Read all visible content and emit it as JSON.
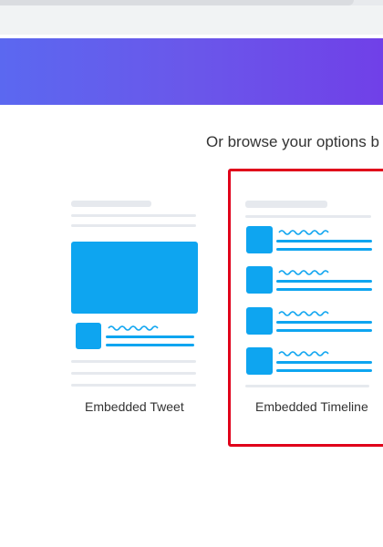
{
  "browse_heading": "Or browse your options b",
  "options": [
    {
      "label": "Embedded Tweet",
      "icon": "embedded-tweet-illustration"
    },
    {
      "label": "Embedded Timeline",
      "icon": "embedded-timeline-illustration",
      "selected": true
    }
  ],
  "colors": {
    "hero_gradient_start": "#5b68f0",
    "hero_gradient_end": "#7040e8",
    "accent_blue": "#0ea5f0",
    "placeholder_grey": "#e6e9ee",
    "selection_outline": "#e0001a"
  }
}
